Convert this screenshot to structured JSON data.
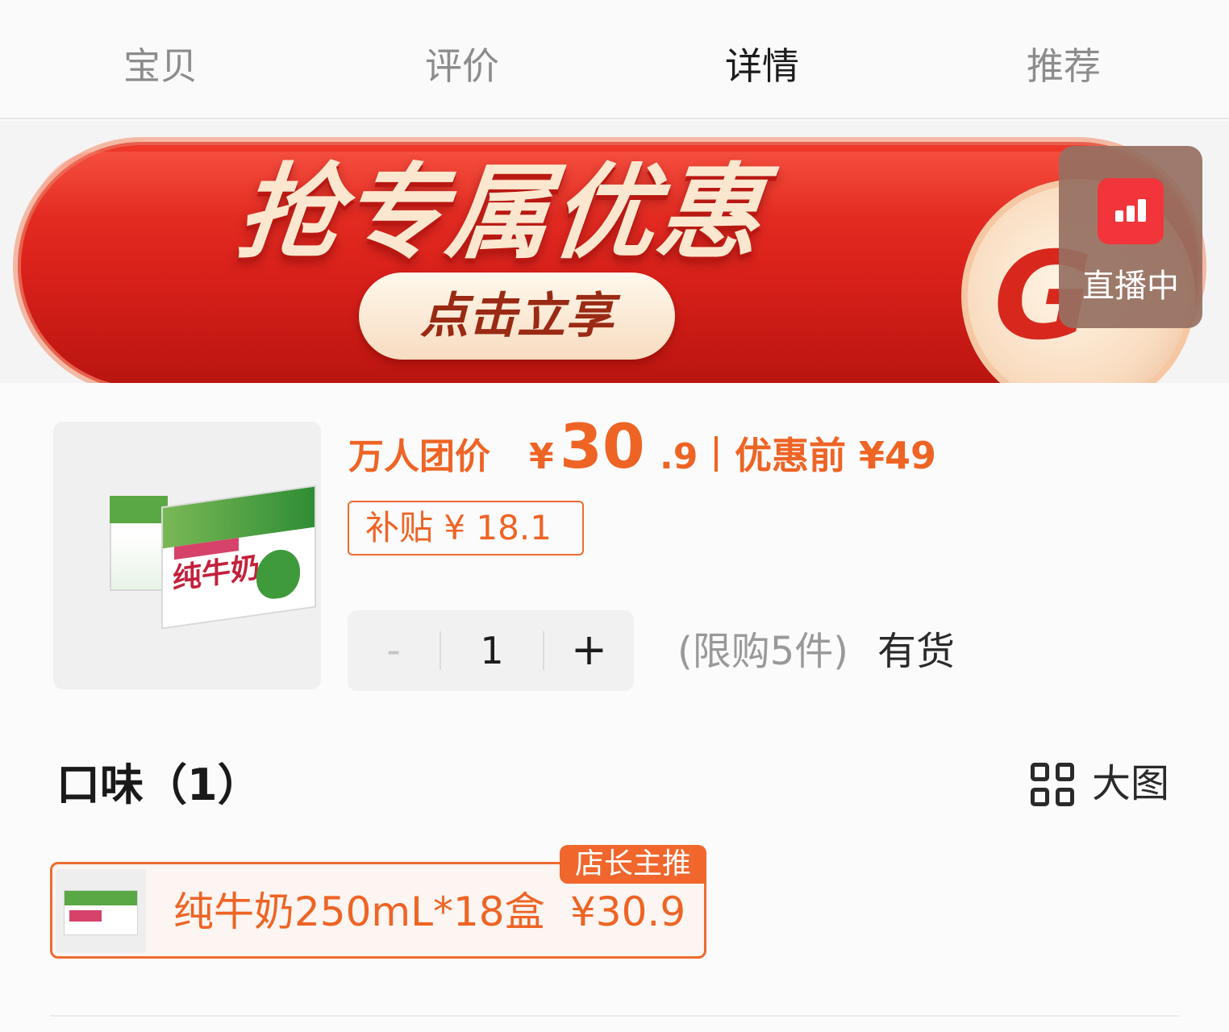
{
  "tabs": [
    {
      "label": "宝贝",
      "active": false
    },
    {
      "label": "评价",
      "active": false
    },
    {
      "label": "详情",
      "active": true
    },
    {
      "label": "推荐",
      "active": false
    }
  ],
  "banner": {
    "headline": "抢专属优惠",
    "cta": "点击立享",
    "coin_letter": "G",
    "colors": {
      "primary": "#e22a1f",
      "text": "#fbe7cf"
    }
  },
  "live_badge": {
    "icon": "live-stats-icon",
    "label": "直播中"
  },
  "product": {
    "image_alt": "纯牛奶",
    "image_box_text": "纯牛奶",
    "price_label": "万人团价",
    "currency": "¥",
    "price_int": "30",
    "price_dec": ".9",
    "orig_price_text": "优惠前 ¥49",
    "subsidy_text": "补贴 ¥ 18.1",
    "quantity": "1",
    "minus": "-",
    "plus": "+",
    "limit_text": "(限购5件)",
    "stock_text": "有货",
    "accent_color": "#ee6425"
  },
  "flavor": {
    "title": "口味（1）",
    "view_toggle_icon": "grid-icon",
    "view_toggle_label": "大图",
    "options": [
      {
        "name": "纯牛奶250mL*18盒",
        "price": "¥30.9",
        "badge": "店长主推",
        "selected": true
      }
    ]
  }
}
